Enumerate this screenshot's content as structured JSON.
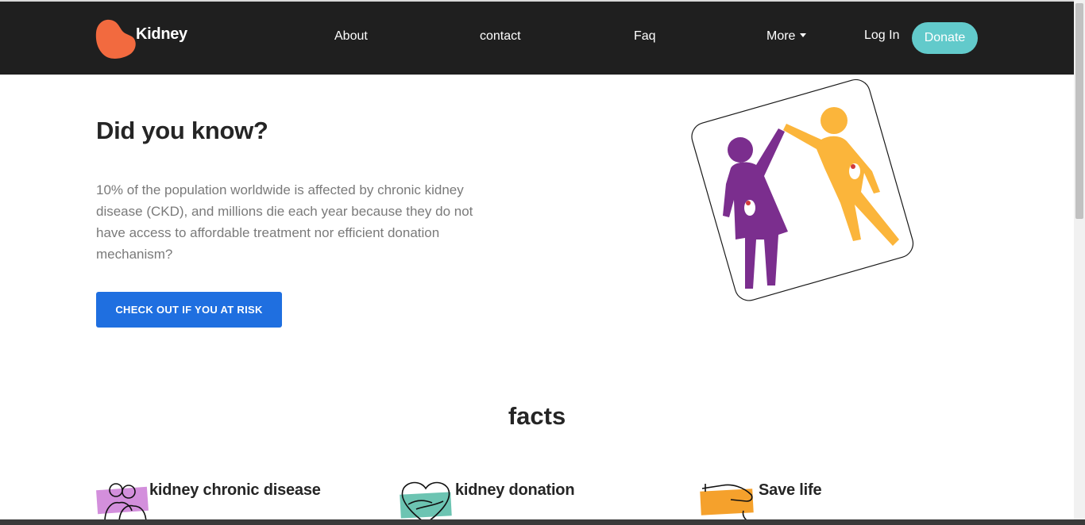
{
  "brand": {
    "name": "Kidney",
    "logo_color": "#f26a3f"
  },
  "nav": {
    "about": "About",
    "contact": "contact",
    "faq": "Faq",
    "more": "More",
    "login": "Log In",
    "donate": "Donate"
  },
  "hero": {
    "title": "Did you know?",
    "text": "10% of the population worldwide is affected by chronic kidney disease (CKD), and millions die each year because they do not have access to affordable treatment nor efficient donation mechanism?",
    "cta": "CHECK OUT IF YOU AT RISK"
  },
  "facts": {
    "title": "facts",
    "items": [
      {
        "title": "kidney chronic disease",
        "icon": "two-people-icon"
      },
      {
        "title": "kidney donation",
        "icon": "heart-hands-icon"
      },
      {
        "title": "Save life",
        "icon": "helping-hand-icon"
      }
    ]
  },
  "colors": {
    "navbar": "#1f1f1f",
    "donate": "#62cacb",
    "cta": "#1f6fe0",
    "purple": "#7b2e8e",
    "yellow": "#fbb53b"
  }
}
